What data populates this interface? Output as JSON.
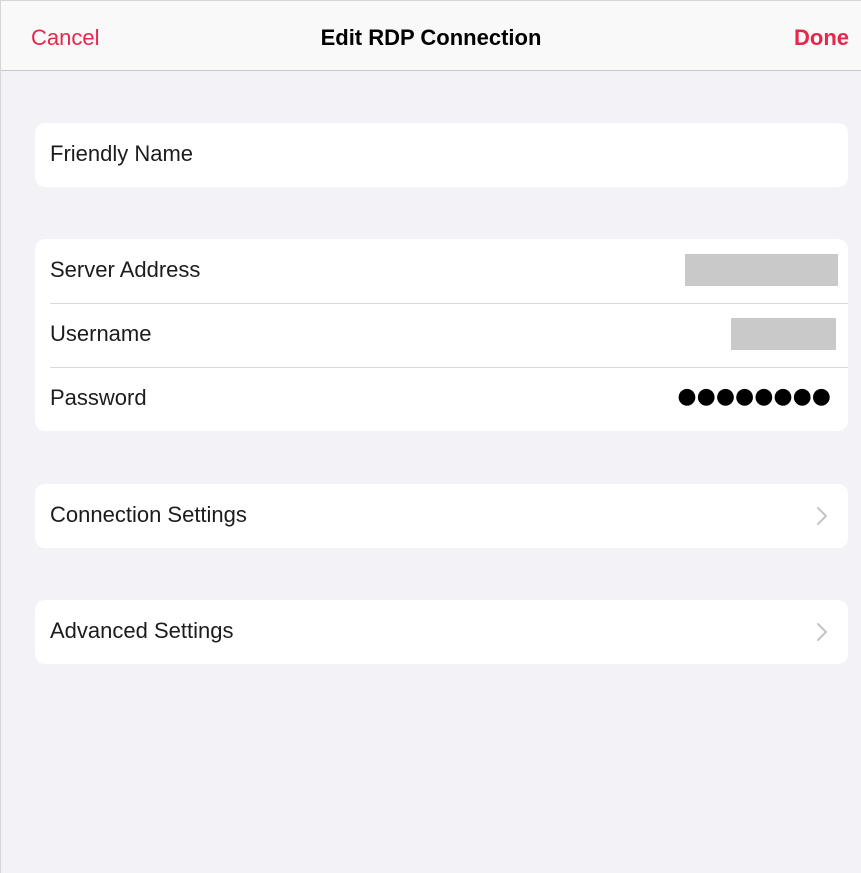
{
  "navbar": {
    "cancel_label": "Cancel",
    "title": "Edit RDP Connection",
    "done_label": "Done"
  },
  "colors": {
    "accent": "#e6264a",
    "background": "#f2f2f7",
    "cell": "#ffffff",
    "separator": "#d9d9de",
    "redaction": "#c9c9c9"
  },
  "groups": {
    "name": {
      "friendly_name_label": "Friendly Name"
    },
    "credentials": {
      "server_address_label": "Server Address",
      "username_label": "Username",
      "password_label": "Password",
      "password_value": "●●●●●●●●"
    },
    "connection": {
      "label": "Connection Settings",
      "icon": "chevron-right-icon"
    },
    "advanced": {
      "label": "Advanced Settings",
      "icon": "chevron-right-icon"
    }
  }
}
